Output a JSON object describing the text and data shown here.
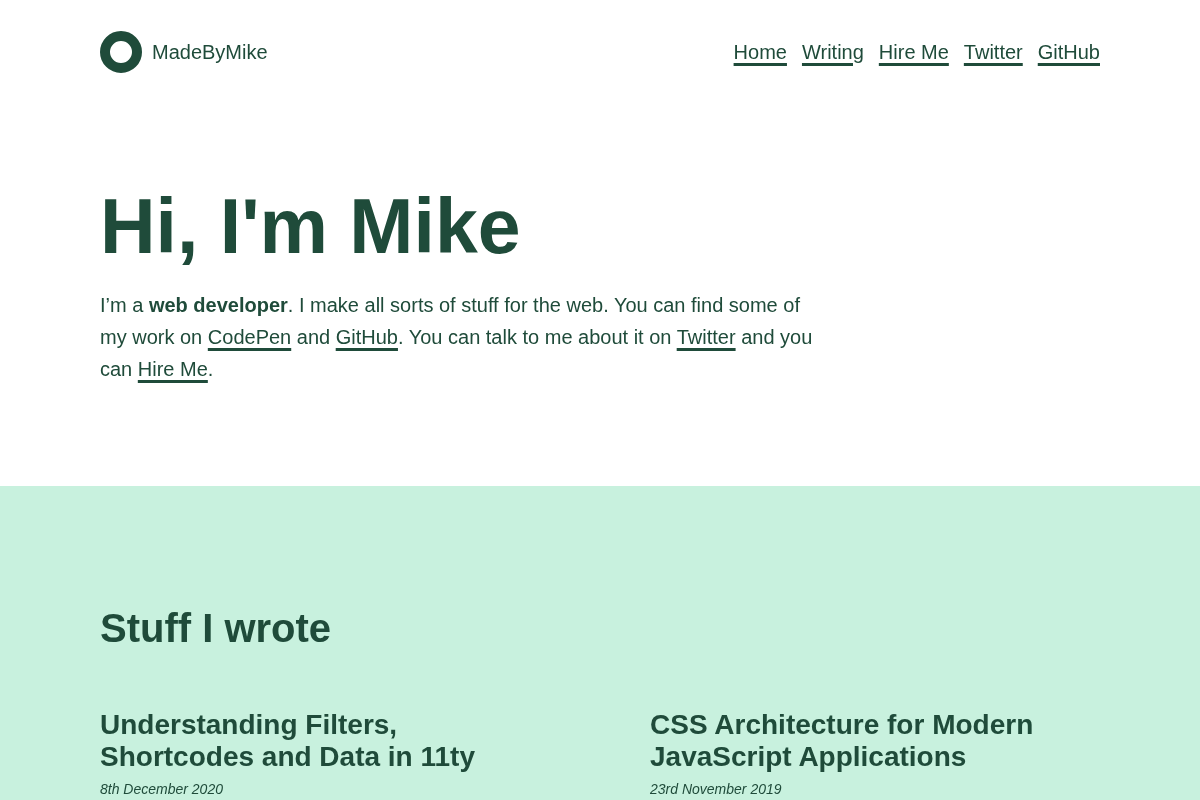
{
  "header": {
    "logo_text": "MadeByMike",
    "nav": [
      "Home",
      "Writing",
      "Hire Me",
      "Twitter",
      "GitHub"
    ]
  },
  "hero": {
    "title": "Hi, I'm Mike",
    "intro": [
      {
        "kind": "text",
        "text": "I’m a **web developer**. I make all sorts of stuff for the web. You can find some of my work on "
      },
      {
        "kind": "link",
        "text": "CodePen"
      },
      {
        "kind": "text",
        "text": " and "
      },
      {
        "kind": "link",
        "text": "GitHub"
      },
      {
        "kind": "text",
        "text": ". You can talk to me about it on "
      },
      {
        "kind": "link",
        "text": "Twitter"
      },
      {
        "kind": "text",
        "text": " and you can "
      },
      {
        "kind": "link",
        "text": "Hire Me"
      },
      {
        "kind": "text",
        "text": "."
      }
    ]
  },
  "writing": {
    "title": "Stuff I wrote",
    "articles": [
      {
        "title": "Understanding Filters, Shortcodes and Data in 11ty",
        "date": "8th December 2020"
      },
      {
        "title": "CSS Architecture for Modern JavaScript Applications",
        "date": "23rd November 2019"
      }
    ]
  }
}
